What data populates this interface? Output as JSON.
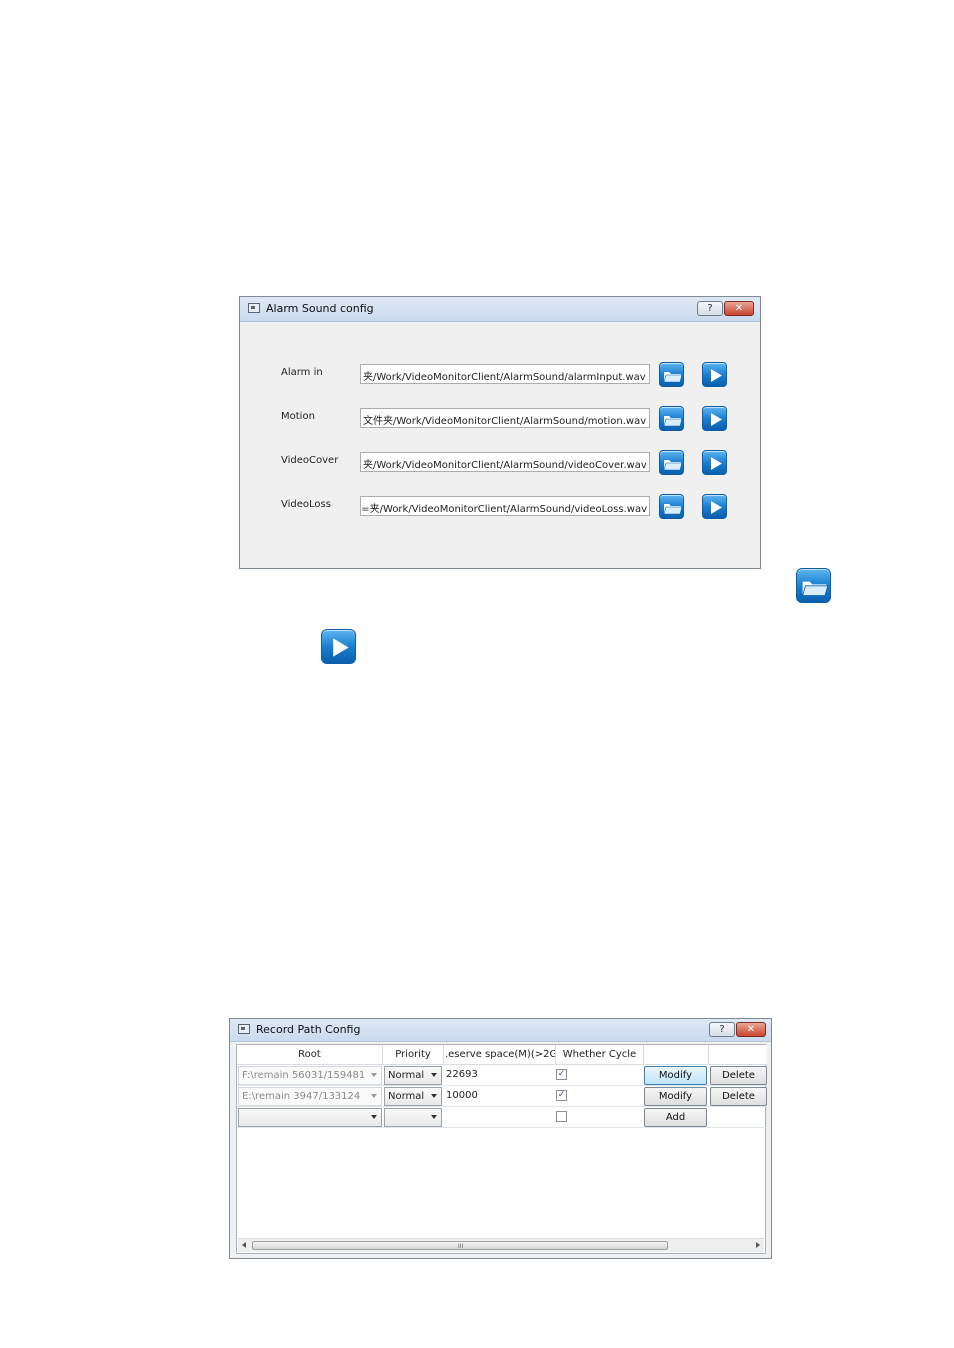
{
  "alarm_dialog": {
    "title": "Alarm Sound config",
    "help_label": "?",
    "close_label": "✕",
    "rows": [
      {
        "label": "Alarm in",
        "path": "夹/Work/VideoMonitorClient/AlarmSound/alarmInput.wav"
      },
      {
        "label": "Motion",
        "path": "文件夹/Work/VideoMonitorClient/AlarmSound/motion.wav"
      },
      {
        "label": "VideoCover",
        "path": "夹/Work/VideoMonitorClient/AlarmSound/videoCover.wav"
      },
      {
        "label": "VideoLoss",
        "path": "=夹/Work/VideoMonitorClient/AlarmSound/videoLoss.wav"
      }
    ],
    "icons": {
      "browse": "folder-icon",
      "play": "play-icon"
    },
    "accent_color": "#1a7fd0"
  },
  "record_dialog": {
    "title": "Record Path Config",
    "help_label": "?",
    "close_label": "✕",
    "columns": [
      "Root",
      "Priority",
      ".eserve space(M)(>2G",
      "Whether Cycle",
      "",
      ""
    ],
    "rows": [
      {
        "root": "F:\\remain 56031/159481",
        "priority": "Normal",
        "reserve": "22693",
        "cycle": true,
        "modify_label": "Modify",
        "delete_label": "Delete"
      },
      {
        "root": "E:\\remain 3947/133124",
        "priority": "Normal",
        "reserve": "10000",
        "cycle": true,
        "modify_label": "Modify",
        "delete_label": "Delete"
      }
    ],
    "new_row": {
      "root": "",
      "priority": "",
      "reserve": "",
      "cycle": false,
      "add_label": "Add"
    },
    "scroll_grip": "III"
  }
}
